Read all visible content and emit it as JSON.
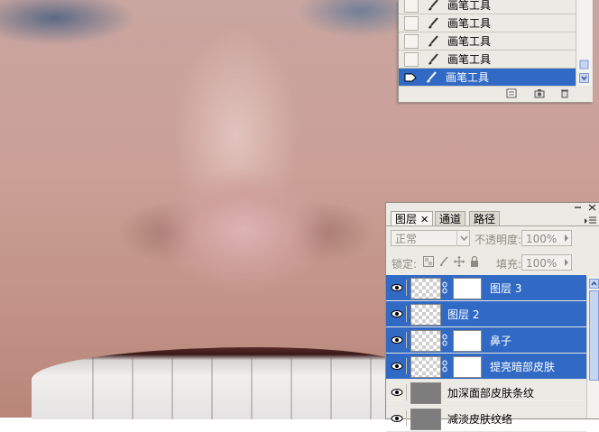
{
  "history": {
    "items": [
      {
        "label": "画笔工具",
        "selected": false
      },
      {
        "label": "画笔工具",
        "selected": false
      },
      {
        "label": "画笔工具",
        "selected": false
      },
      {
        "label": "画笔工具",
        "selected": false
      },
      {
        "label": "画笔工具",
        "selected": true
      }
    ],
    "footer_icons": [
      "new-document-icon",
      "snapshot-camera-icon",
      "trash-icon"
    ]
  },
  "layers_panel": {
    "tabs": [
      {
        "label": "图层",
        "active": true
      },
      {
        "label": "通道",
        "active": false
      },
      {
        "label": "路径",
        "active": false
      }
    ],
    "blend_mode": "正常",
    "opacity_label": "不透明度:",
    "opacity_value": "100%",
    "lock_label": "锁定:",
    "fill_label": "填充:",
    "fill_value": "100%",
    "layers": [
      {
        "name": "图层 3",
        "selected": true,
        "has_mask": true,
        "thumb": "transparent"
      },
      {
        "name": "图层 2",
        "selected": true,
        "has_mask": false,
        "thumb": "transparent"
      },
      {
        "name": "鼻子",
        "selected": true,
        "has_mask": true,
        "thumb": "transparent"
      },
      {
        "name": "提亮暗部皮肤",
        "selected": true,
        "has_mask": true,
        "thumb": "transparent"
      },
      {
        "name": "加深面部皮肤条纹",
        "selected": false,
        "has_mask": false,
        "thumb": "gray"
      },
      {
        "name": "减淡皮肤纹络",
        "selected": false,
        "has_mask": false,
        "thumb": "gray"
      }
    ]
  },
  "colors": {
    "selection": "#316ac5",
    "panel_bg": "#eceae4"
  }
}
